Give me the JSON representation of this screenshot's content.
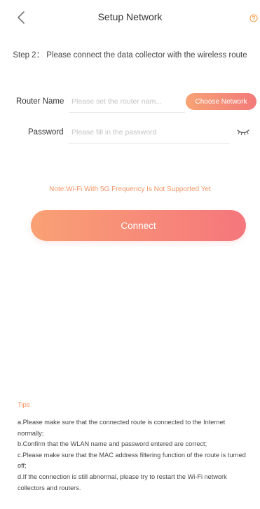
{
  "header": {
    "title": "Setup Network",
    "back_icon": "chevron-left-icon",
    "help_icon": "question-circle-icon"
  },
  "step": {
    "text": "Step 2： Please connect the data collector with the wireless route"
  },
  "router": {
    "label": "Router Name",
    "placeholder": "Please set the router nam...",
    "choose_button": "Choose Network"
  },
  "password": {
    "label": "Password",
    "placeholder": "Please fill in the password",
    "toggle_icon": "eye-closed-icon"
  },
  "note": "Note:Wi-Fi With 5G Frequency Is Not Supported Yet",
  "connect_label": "Connect",
  "tips": {
    "title": "Tips",
    "items": [
      "a.Please make sure that the connected route is connected to the Internet normally;",
      "b.Confirm that the WLAN name and password entered are correct;",
      "c.Please make sure that the MAC address filtering function of the route is turned off;",
      "d.If the connection is still abnormal, please try to restart the Wi-Fi network collectors and routers."
    ]
  },
  "colors": {
    "accent": "#f5946a",
    "gradient_start": "#f9a174",
    "gradient_end": "#f5767c",
    "note": "#f49566"
  }
}
